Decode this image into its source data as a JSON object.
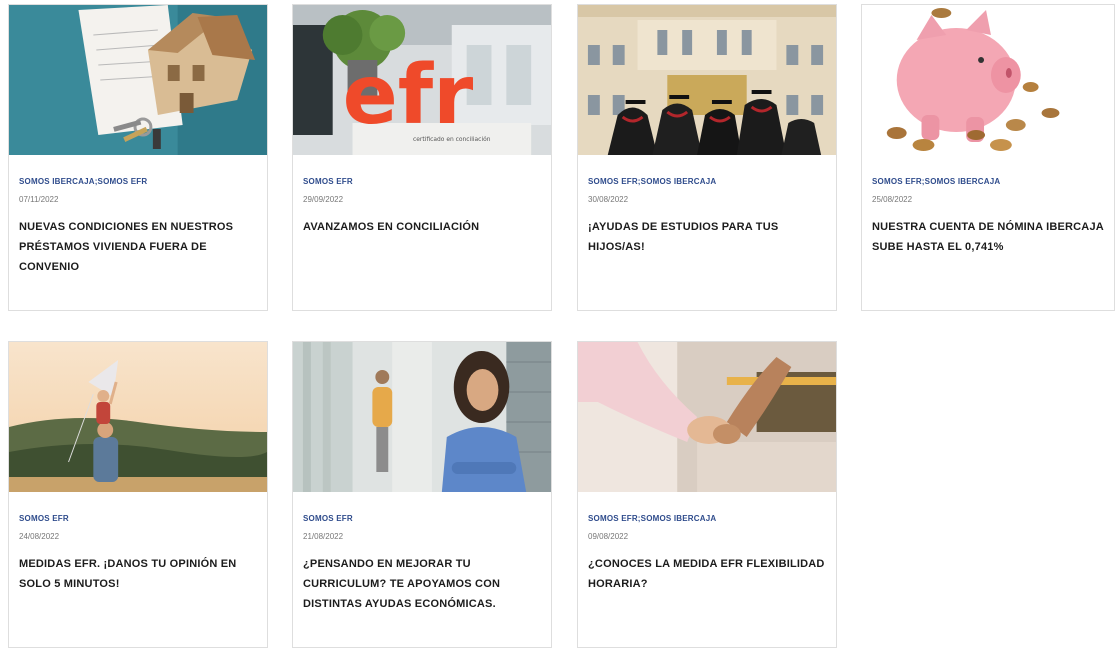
{
  "posts": [
    {
      "category": "SOMOS IBERCAJA;SOMOS EFR",
      "date": "07/11/2022",
      "title": "NUEVAS CONDICIONES EN NUESTROS PRÉSTAMOS VIVIENDA FUERA DE CONVENIO",
      "image": "house-model-keys-image"
    },
    {
      "category": "SOMOS EFR",
      "date": "29/09/2022",
      "title": "AVANZAMOS EN CONCILIACIÓN",
      "image": "efr-letters-image",
      "image_text": "efr",
      "image_caption": "certificado en conciliación"
    },
    {
      "category": "SOMOS EFR;SOMOS IBERCAJA",
      "date": "30/08/2022",
      "title": "¡AYUDAS DE ESTUDIOS PARA TUS HIJOS/AS!",
      "image": "graduates-building-image"
    },
    {
      "category": "SOMOS EFR;SOMOS IBERCAJA",
      "date": "25/08/2022",
      "title": "NUESTRA CUENTA DE NÓMINA IBERCAJA SUBE HASTA EL 0,741%",
      "image": "piggy-bank-coins-image"
    },
    {
      "category": "SOMOS EFR",
      "date": "24/08/2022",
      "title": "MEDIDAS EFR. ¡DANOS TU OPINIÓN EN SOLO 5 MINUTOS!",
      "image": "father-child-kite-image"
    },
    {
      "category": "SOMOS EFR",
      "date": "21/08/2022",
      "title": "¿PENSANDO EN MEJORAR TU CURRICULUM? TE APOYAMOS CON DISTINTAS AYUDAS ECONÓMICAS.",
      "image": "smiling-woman-office-image"
    },
    {
      "category": "SOMOS EFR;SOMOS IBERCAJA",
      "date": "09/08/2022",
      "title": "¿CONOCES LA MEDIDA EFR FLEXIBILIDAD HORARIA?",
      "image": "holding-hands-image"
    }
  ]
}
